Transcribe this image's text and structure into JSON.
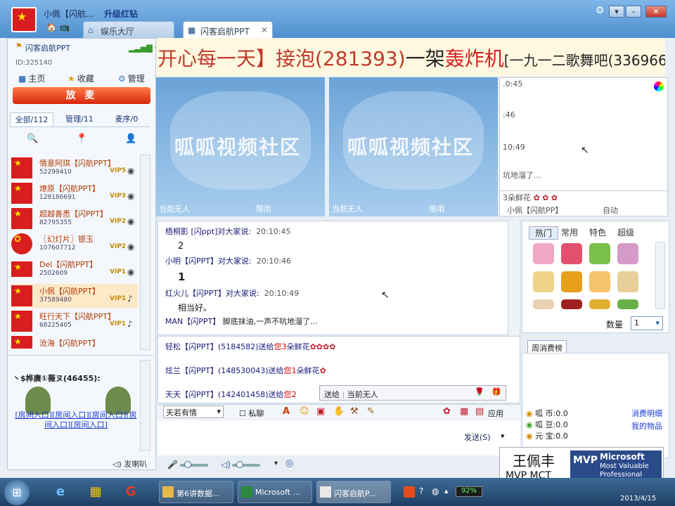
{
  "titlebar": {
    "user_nick": "小佩【闪航...",
    "upgrade": "升级红钻",
    "tabs": [
      {
        "label": "娱乐大厅"
      },
      {
        "label": "闪客启航PPT"
      }
    ]
  },
  "left": {
    "room_name": "闪客启航PPT",
    "room_id": "ID:325140",
    "nav": [
      "主页",
      "收藏",
      "管理"
    ],
    "mic_button": "放 麦",
    "tabs": [
      "全部/112",
      "管理/11",
      "麦序/0"
    ],
    "members": [
      {
        "name": "情意阿琪【闪航PPT】",
        "id": "52299410",
        "vip": "VIP5"
      },
      {
        "name": "燎原【闪航PPT】",
        "id": "128186691",
        "vip": "VIP3"
      },
      {
        "name": "超越善悉【闪PPT】",
        "id": "82795355",
        "vip": "VIP2"
      },
      {
        "name": "〖幻灯片〗银玉",
        "id": "107607712",
        "vip": "VIP2"
      },
      {
        "name": "Del【闪航PPT】",
        "id": "2502609",
        "vip": "VIP1"
      },
      {
        "name": "小佩【闪航PPT】",
        "id": "37589480",
        "vip": "VIP1"
      },
      {
        "name": "旺行天下【闪航PPT】",
        "id": "68225405",
        "vip": "VIP1"
      },
      {
        "name": "沧海【闪航PPT】",
        "id": "",
        "vip": ""
      }
    ],
    "promo": "丶$桦廣①薇ヌ(46455):",
    "room_links": "[房间入口][房间入口][房间入口][房间入口][房间入口]"
  },
  "banner": {
    "seg1": "开心每一天】接泡(281393)",
    "seg2": "一架",
    "seg3": "轰炸机",
    "seg4": "[一九一二歌舞吧(336966"
  },
  "videos": [
    {
      "watermark": "呱呱视频社区",
      "status": "当前无人",
      "mode": "限用"
    },
    {
      "watermark": "呱呱视频社区",
      "status": "当前无人",
      "mode": "限用"
    }
  ],
  "mini": {
    "lines": [
      ".0:45",
      ":46",
      "10:49",
      "坑地溜了..."
    ],
    "gift_line": "3朵鲜花",
    "footer_user": "小佩【闪航PP】",
    "footer_mode": "自动"
  },
  "chat": [
    {
      "user": "梧桐影 [闪ppt]",
      "said": "对大家说:",
      "time": "20:10:45",
      "msg": "2"
    },
    {
      "user": "小明【闪PPT】",
      "said": "对大家说:",
      "time": "20:10:46",
      "msg": "1"
    },
    {
      "user": "红火儿【闪PPT】",
      "said": "对大家说:",
      "time": "20:10:49",
      "msg": "相当好。"
    },
    {
      "user": "MAN【闪PPT】",
      "said": "",
      "time": "",
      "msg": "脚底抹油,一声不吭地溜了..."
    }
  ],
  "gifts": [
    {
      "text": "轻松【闪PPT】(5184582)送给",
      "you": "您",
      "qty": "3",
      "item": "朵鲜花"
    },
    {
      "text": "炫兰【闪PPT】(148530043)送给",
      "you": "您",
      "qty": "1",
      "item": "朵鲜花"
    },
    {
      "text": "天天【闪PPT】(142401458)送给",
      "you": "您",
      "qty": "2",
      "item": ""
    }
  ],
  "sendto": {
    "label": "送给",
    "target": "当前无人"
  },
  "toolbar": {
    "font": "天若有情",
    "private": "私聊",
    "apply": "应用",
    "send": "发送(S)"
  },
  "bottom": {
    "horn": "发喇叭"
  },
  "giftpanel": {
    "tabs": [
      "热门",
      "常用",
      "特色",
      "超级"
    ],
    "qty_label": "数量",
    "qty": "1",
    "weekly": "周消费榜"
  },
  "wealth": {
    "rows": [
      {
        "label": "呱 币:0.0",
        "link": "消费明细"
      },
      {
        "label": "呱 豆:0.0",
        "link": "我的物品"
      },
      {
        "label": "元 宝:0.0",
        "link": ""
      }
    ]
  },
  "mvp": {
    "name": "王佩丰",
    "sub": "MVP MCT",
    "logo_brand": "Microsoft",
    "logo_line2": "Most Valuable",
    "logo_line3": "Professional",
    "logo_mark": "MVP"
  },
  "taskbar": {
    "items": [
      "第6讲数据...",
      "Microsoft ...",
      "闪客启航P..."
    ],
    "battery": "92%",
    "date": "2013/4/15"
  },
  "colors": {
    "accent": "#4f8fcf",
    "mic": "#d8280d",
    "banner_text": "#c0392b"
  }
}
